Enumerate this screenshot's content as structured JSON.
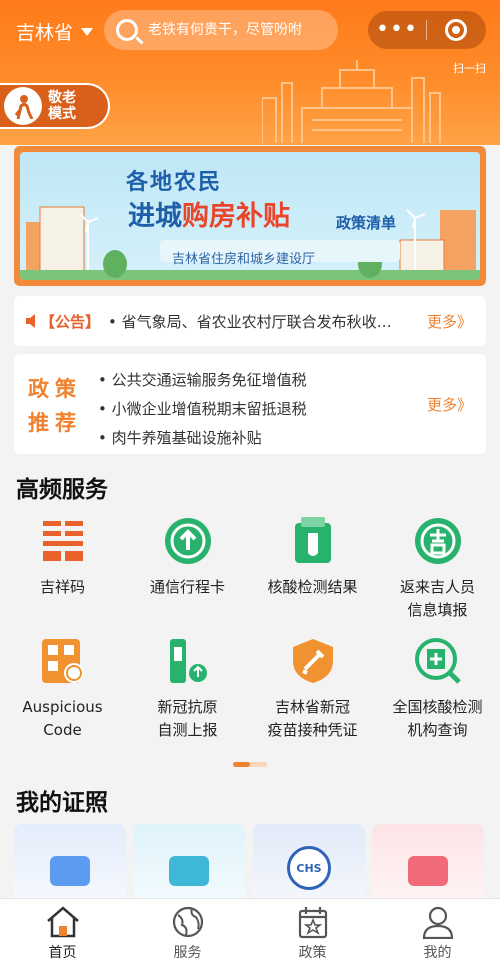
{
  "header": {
    "city": "吉林省",
    "search_placeholder": "老铁有何贵干，尽管吩咐",
    "capsule_menu": "•••",
    "scan_label": "扫一扫",
    "elder_mode": [
      "敬老",
      "模式"
    ]
  },
  "banner": {
    "line1": "各地农民",
    "line2_a": "进城",
    "line2_b": "购房补贴",
    "line3": "政策清单",
    "source": "吉林省住房和城乡建设厅"
  },
  "notice": {
    "tag": "【公告】",
    "text": "• 省气象局、省农业农村厅联合发布秋收…",
    "more": "更多》"
  },
  "policy": {
    "title": [
      "政策",
      "推荐"
    ],
    "items": [
      "• 公共交通运输服务免征增值税",
      "• 小微企业增值税期末留抵退税",
      "• 肉牛养殖基础设施补贴"
    ],
    "more": "更多》"
  },
  "high_frequency": {
    "title": "高频服务",
    "items": [
      {
        "label": "吉祥码",
        "icon": "jixiang-code-icon"
      },
      {
        "label": "通信行程卡",
        "icon": "arrow-up-circle-icon"
      },
      {
        "label": "核酸检测结果",
        "icon": "test-tube-icon"
      },
      {
        "label": "返来吉人员\n信息填报",
        "icon": "ji-circle-icon"
      },
      {
        "label": "Auspicious\nCode",
        "icon": "qr-globe-icon"
      },
      {
        "label": "新冠抗原\n自测上报",
        "icon": "antigen-kit-icon"
      },
      {
        "label": "吉林省新冠\n疫苗接种凭证",
        "icon": "vaccine-shield-icon"
      },
      {
        "label": "全国核酸检测\n机构查询",
        "icon": "hospital-search-icon"
      }
    ]
  },
  "certificates": {
    "title": "我的证照",
    "items": [
      {
        "icon": "id-card-icon",
        "color": "#5b9bf0"
      },
      {
        "icon": "social-card-icon",
        "color": "#3fb8d8"
      },
      {
        "icon": "chs-medical-icon",
        "color": "#2e63b8"
      },
      {
        "icon": "driver-license-icon",
        "color": "#f06a7a"
      }
    ],
    "chs_label": "CHS"
  },
  "tabbar": {
    "items": [
      {
        "label": "首页",
        "icon": "home-icon"
      },
      {
        "label": "服务",
        "icon": "globe-icon"
      },
      {
        "label": "政策",
        "icon": "calendar-star-icon"
      },
      {
        "label": "我的",
        "icon": "user-icon"
      }
    ]
  },
  "colors": {
    "primary": "#ff7a1a",
    "accent": "#f0822f",
    "green": "#27b36d",
    "blue": "#1e5faa"
  }
}
